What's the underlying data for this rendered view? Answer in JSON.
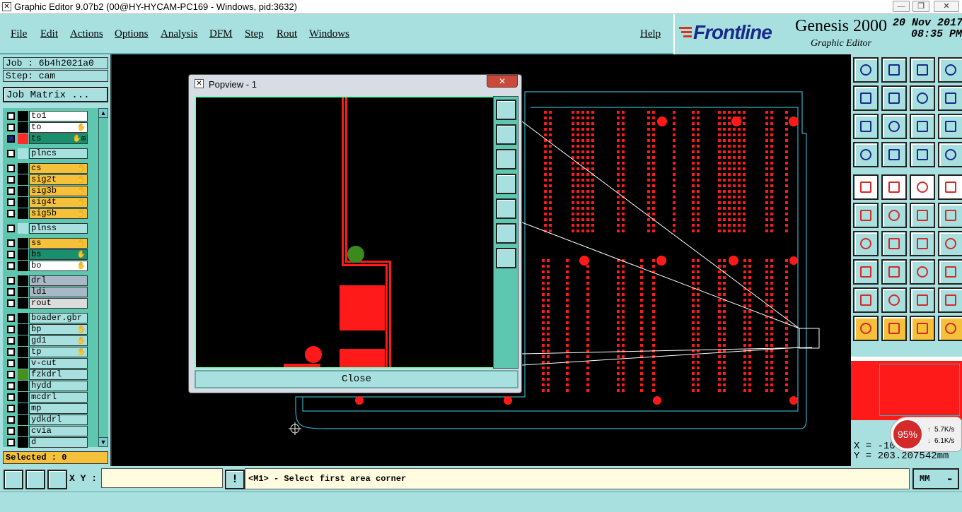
{
  "window": {
    "title": "Graphic Editor 9.07b2 (00@HY-HYCAM-PC169 - Windows, pid:3632)"
  },
  "menu": [
    "File",
    "Edit",
    "Actions",
    "Options",
    "Analysis",
    "DFM",
    "Step",
    "Rout",
    "Windows"
  ],
  "help": "Help",
  "brand": {
    "logo": "Frontline",
    "product": "Genesis 2000",
    "sub": "Graphic Editor",
    "date": "20 Nov 2017",
    "time": "08:35 PM"
  },
  "job": {
    "label": "Job : 6b4h2021a0",
    "step": "Step: cam",
    "matrix": "Job Matrix ..."
  },
  "layers": [
    {
      "name": "to1",
      "color": "#ffffff",
      "sw": "#000000"
    },
    {
      "name": "to",
      "color": "#ffffff",
      "sw": "#000000",
      "mark": "✋"
    },
    {
      "name": "ts",
      "color": "#1a8f6e",
      "sw": "#ff2a2a",
      "mark": "✋⊞",
      "active": true
    },
    {
      "name": "plncs",
      "color": "#a8e0e0",
      "sw": "#a8e0e0"
    },
    {
      "name": "cs",
      "color": "#f5c13a",
      "sw": "#000000",
      "mark": "✋"
    },
    {
      "name": "sig2t",
      "color": "#f5c13a",
      "sw": "#000000",
      "mark": "✋"
    },
    {
      "name": "sig3b",
      "color": "#f5c13a",
      "sw": "#000000",
      "mark": "✋"
    },
    {
      "name": "sig4t",
      "color": "#f5c13a",
      "sw": "#000000",
      "mark": "✋"
    },
    {
      "name": "sig5b",
      "color": "#f5c13a",
      "sw": "#000000",
      "mark": "✋"
    },
    {
      "name": "plnss",
      "color": "#a8e0e0",
      "sw": "#a8e0e0"
    },
    {
      "name": "ss",
      "color": "#f5c13a",
      "sw": "#000000",
      "mark": "✋"
    },
    {
      "name": "bs",
      "color": "#1a8f6e",
      "sw": "#000000",
      "mark": "✋"
    },
    {
      "name": "bo",
      "color": "#ffffff",
      "sw": "#000000",
      "mark": "✋"
    },
    {
      "name": "drl",
      "color": "#a9b8c6",
      "sw": "#000000"
    },
    {
      "name": "ldi",
      "color": "#a9b8c6",
      "sw": "#000000"
    },
    {
      "name": "rout",
      "color": "#dcdcdc",
      "sw": "#000000"
    },
    {
      "name": "boader.gbr",
      "color": "#a8e0e0",
      "sw": "#000000"
    },
    {
      "name": "bp",
      "color": "#a8e0e0",
      "sw": "#000000",
      "mark": "✋"
    },
    {
      "name": "gd1",
      "color": "#a8e0e0",
      "sw": "#000000",
      "mark": "✋"
    },
    {
      "name": "tp",
      "color": "#a8e0e0",
      "sw": "#000000",
      "mark": "✋"
    },
    {
      "name": "v-cut",
      "color": "#a8e0e0",
      "sw": "#000000"
    },
    {
      "name": "fzkdrl",
      "color": "#a8e0e0",
      "sw": "#4a8f1e"
    },
    {
      "name": "hydd",
      "color": "#a8e0e0",
      "sw": "#000000"
    },
    {
      "name": "mcdrl",
      "color": "#a8e0e0",
      "sw": "#000000"
    },
    {
      "name": "mp",
      "color": "#a8e0e0",
      "sw": "#000000"
    },
    {
      "name": "ydkdrl",
      "color": "#a8e0e0",
      "sw": "#000000"
    },
    {
      "name": "cvia",
      "color": "#a8e0e0",
      "sw": "#000000"
    },
    {
      "name": "d",
      "color": "#a8e0e0",
      "sw": "#000000"
    }
  ],
  "selected": "Selected : 0",
  "popup": {
    "title": "Popview - 1",
    "close": "Close",
    "close_x": "✕"
  },
  "status": {
    "xy_label": "X Y :",
    "message": "<M1> - Select first area corner",
    "units": "MM",
    "warn": "!"
  },
  "coords": {
    "x": "X = -10",
    "y": "Y = 203.207542mm"
  },
  "net": {
    "percent": "95%",
    "up": "5.7K/s",
    "down": "6.1K/s"
  }
}
